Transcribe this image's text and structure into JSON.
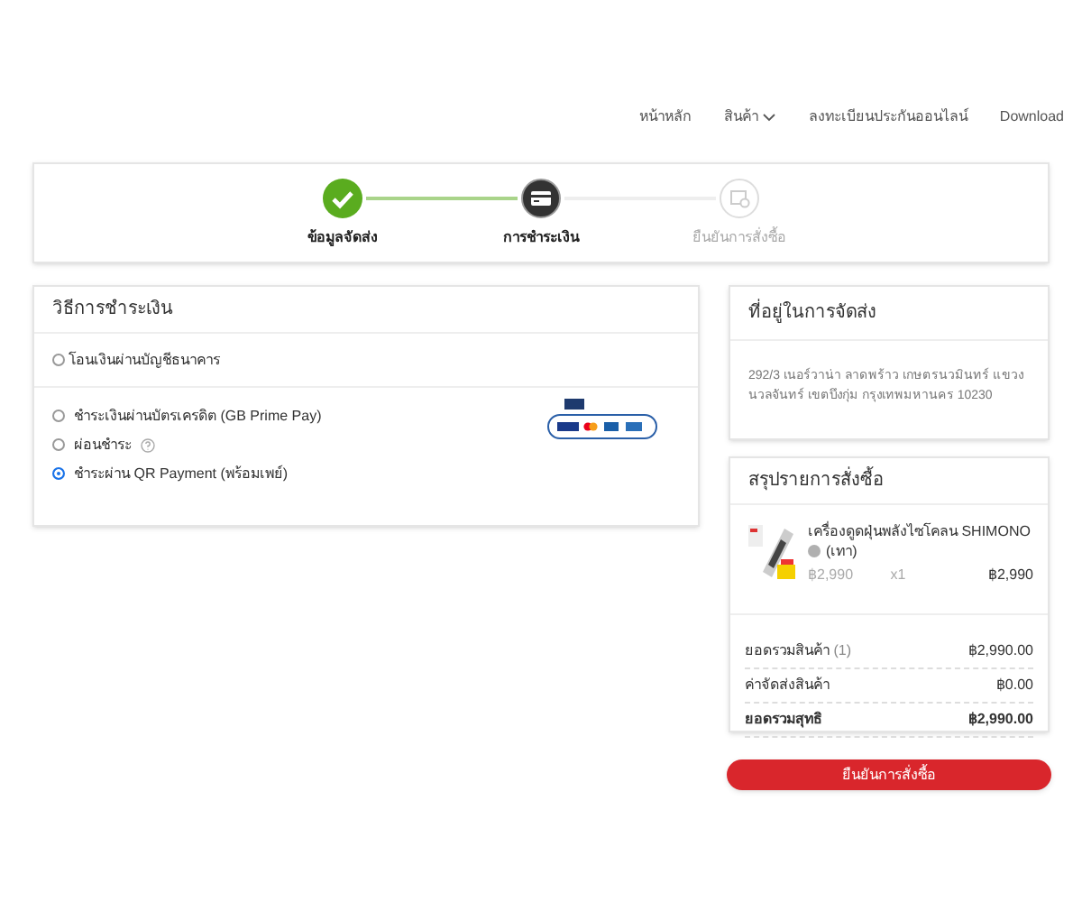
{
  "nav": [
    {
      "label": "หน้าหลัก",
      "dropdown": false
    },
    {
      "label": "สินค้า",
      "dropdown": true
    },
    {
      "label": "ลงทะเบียนประกันออนไลน์",
      "dropdown": false
    },
    {
      "label": "Download",
      "dropdown": false
    }
  ],
  "steps": [
    {
      "label": "ข้อมูลจัดส่ง",
      "kind": "done"
    },
    {
      "label": "การชำระเงิน",
      "kind": "current"
    },
    {
      "label": "ยืนยันการสั่งซื้อ",
      "kind": "pending"
    }
  ],
  "payment": {
    "title": "วิธีการชำระเงิน",
    "bank_option": {
      "label": "โอนเงินผ่านบัญชีธนาคาร",
      "selected": false
    },
    "options": [
      {
        "label": "ชำระเงินผ่านบัตรเครดิต (GB Prime Pay)",
        "selected": false,
        "help": false
      },
      {
        "label": "ผ่อนชำระ",
        "selected": false,
        "help": true
      },
      {
        "label": "ชำระผ่าน QR Payment (พร้อมเพย์)",
        "selected": true,
        "help": false
      }
    ]
  },
  "address": {
    "title": "ที่อยู่ในการจัดส่ง",
    "text": "292/3 เนอร์วาน่า ลาดพร้าว เกษตรนวมินทร์ แขวง นวลจันทร์ เขตบึงกุ่ม กรุงเทพมหานคร 10230"
  },
  "summary": {
    "title": "สรุปรายการสั่งซื้อ",
    "item": {
      "name": "เครื่องดูดฝุ่นพลังไซโคลน SHIMONO",
      "variant": "(เทา)",
      "color": "#b0b0b0",
      "price": "฿2,990",
      "qty": "x1",
      "total": "฿2,990"
    },
    "rows": [
      {
        "label": "ยอดรวมสินค้า",
        "count": "(1)",
        "value": "฿2,990.00",
        "bold": false
      },
      {
        "label": "ค่าจัดส่งสินค้า",
        "value": "฿0.00",
        "bold": false
      },
      {
        "label": "ยอดรวมสุทธิ",
        "value": "฿2,990.00",
        "bold": true
      }
    ],
    "confirm": "ยืนยันการสั่งซื้อ"
  }
}
